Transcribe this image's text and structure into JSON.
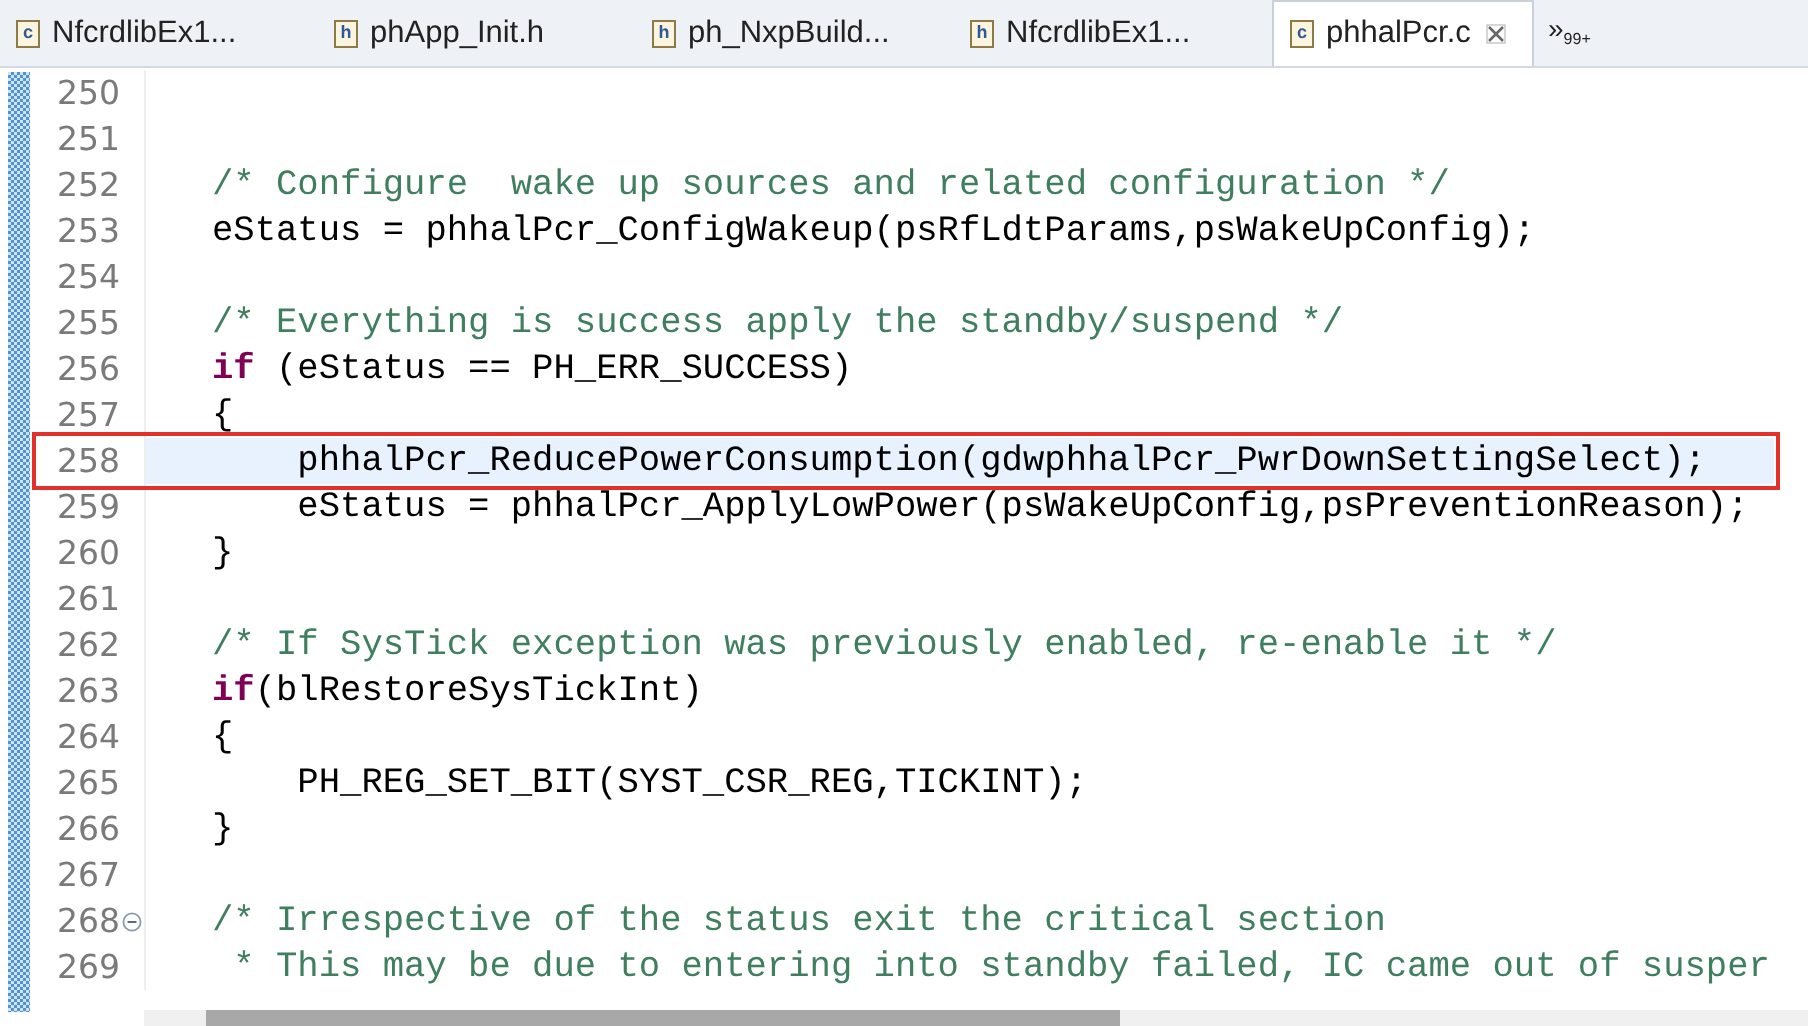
{
  "tabs": [
    {
      "label": "NfcrdlibEx1...",
      "file_type": "c",
      "selected": false
    },
    {
      "label": "phApp_Init.h",
      "file_type": "h",
      "selected": false
    },
    {
      "label": "ph_NxpBuild...",
      "file_type": "h",
      "selected": false
    },
    {
      "label": "NfcrdlibEx1...",
      "file_type": "h",
      "selected": false
    },
    {
      "label": "phhalPcr.c",
      "file_type": "c",
      "selected": true
    }
  ],
  "overflow": {
    "glyph": "»",
    "count": "99+"
  },
  "lines": [
    {
      "number": "250",
      "current": false,
      "foldable": false
    },
    {
      "number": "251",
      "current": false,
      "foldable": false
    },
    {
      "number": "252",
      "current": false,
      "foldable": false,
      "segments": [
        {
          "kind": "comment",
          "text": "/* Configure  wake up sources and related configuration */"
        }
      ]
    },
    {
      "number": "253",
      "current": false,
      "foldable": false,
      "segments": [
        {
          "kind": "plain",
          "text": "eStatus = phhalPcr_ConfigWakeup(psRfLdtParams,psWakeUpConfig);"
        }
      ]
    },
    {
      "number": "254",
      "current": false,
      "foldable": false
    },
    {
      "number": "255",
      "current": false,
      "foldable": false,
      "segments": [
        {
          "kind": "comment",
          "text": "/* Everything is success apply the standby/suspend */"
        }
      ]
    },
    {
      "number": "256",
      "current": false,
      "foldable": false,
      "segments": [
        {
          "kind": "keyword",
          "text": "if"
        },
        {
          "kind": "plain",
          "text": " (eStatus == PH_ERR_SUCCESS)"
        }
      ]
    },
    {
      "number": "257",
      "current": false,
      "foldable": false,
      "segments": [
        {
          "kind": "plain",
          "text": "{"
        }
      ]
    },
    {
      "number": "258",
      "current": true,
      "foldable": false,
      "segments": [
        {
          "kind": "plain",
          "text": "    phhalPcr_ReducePowerConsumption(gdwphhalPcr_PwrDownSettingSelect);"
        }
      ]
    },
    {
      "number": "259",
      "current": false,
      "foldable": false,
      "segments": [
        {
          "kind": "plain",
          "text": "    eStatus = phhalPcr_ApplyLowPower(psWakeUpConfig,psPreventionReason);"
        }
      ]
    },
    {
      "number": "260",
      "current": false,
      "foldable": false,
      "segments": [
        {
          "kind": "plain",
          "text": "}"
        }
      ]
    },
    {
      "number": "261",
      "current": false,
      "foldable": false
    },
    {
      "number": "262",
      "current": false,
      "foldable": false,
      "segments": [
        {
          "kind": "comment",
          "text": "/* If SysTick exception was previously enabled, re-enable it */"
        }
      ]
    },
    {
      "number": "263",
      "current": false,
      "foldable": false,
      "segments": [
        {
          "kind": "keyword",
          "text": "if"
        },
        {
          "kind": "plain",
          "text": "(blRestoreSysTickInt)"
        }
      ]
    },
    {
      "number": "264",
      "current": false,
      "foldable": false,
      "segments": [
        {
          "kind": "plain",
          "text": "{"
        }
      ]
    },
    {
      "number": "265",
      "current": false,
      "foldable": false,
      "segments": [
        {
          "kind": "plain",
          "text": "    PH_REG_SET_BIT(SYST_CSR_REG,TICKINT);"
        }
      ]
    },
    {
      "number": "266",
      "current": false,
      "foldable": false,
      "segments": [
        {
          "kind": "plain",
          "text": "}"
        }
      ]
    },
    {
      "number": "267",
      "current": false,
      "foldable": false
    },
    {
      "number": "268",
      "current": false,
      "foldable": true,
      "segments": [
        {
          "kind": "comment",
          "text": "/* Irrespective of the status exit the critical section"
        }
      ]
    },
    {
      "number": "269",
      "current": false,
      "foldable": false,
      "segments": [
        {
          "kind": "comment",
          "text": " * This may be due to entering into standby failed, IC came out of susper"
        }
      ]
    }
  ]
}
